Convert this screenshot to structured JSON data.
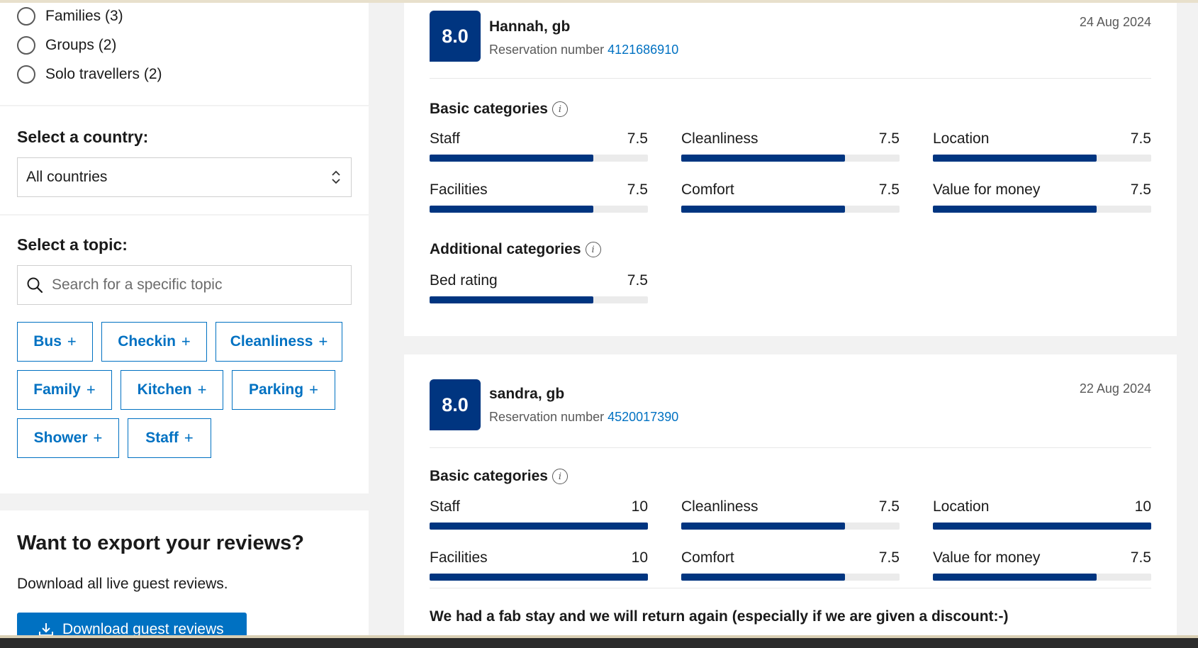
{
  "traveller_filter": {
    "options": [
      {
        "label": "Families (3)"
      },
      {
        "label": "Groups (2)"
      },
      {
        "label": "Solo travellers (2)"
      }
    ]
  },
  "country": {
    "title": "Select a country:",
    "selected": "All countries"
  },
  "topic": {
    "title": "Select a topic:",
    "search_placeholder": "Search for a specific topic",
    "chips": [
      "Bus",
      "Checkin",
      "Cleanliness",
      "Family",
      "Kitchen",
      "Parking",
      "Shower",
      "Staff"
    ],
    "plus": "+"
  },
  "export": {
    "title": "Want to export your reviews?",
    "description": "Download all live guest reviews.",
    "button_label": "Download guest reviews"
  },
  "reviews": [
    {
      "score": "8.0",
      "reviewer": "Hannah, gb",
      "reservation_label": "Reservation number",
      "reservation_number": "4121686910",
      "date": "24 Aug 2024",
      "basic_title": "Basic categories",
      "basic": [
        {
          "label": "Staff",
          "value": "7.5",
          "fraction": 0.75
        },
        {
          "label": "Cleanliness",
          "value": "7.5",
          "fraction": 0.75
        },
        {
          "label": "Location",
          "value": "7.5",
          "fraction": 0.75
        },
        {
          "label": "Facilities",
          "value": "7.5",
          "fraction": 0.75
        },
        {
          "label": "Comfort",
          "value": "7.5",
          "fraction": 0.75
        },
        {
          "label": "Value for money",
          "value": "7.5",
          "fraction": 0.75
        }
      ],
      "additional_title": "Additional categories",
      "additional": [
        {
          "label": "Bed rating",
          "value": "7.5",
          "fraction": 0.75
        }
      ]
    },
    {
      "score": "8.0",
      "reviewer": "sandra, gb",
      "reservation_label": "Reservation number",
      "reservation_number": "4520017390",
      "date": "22 Aug 2024",
      "basic_title": "Basic categories",
      "basic": [
        {
          "label": "Staff",
          "value": "10",
          "fraction": 1.0
        },
        {
          "label": "Cleanliness",
          "value": "7.5",
          "fraction": 0.75
        },
        {
          "label": "Location",
          "value": "10",
          "fraction": 1.0
        },
        {
          "label": "Facilities",
          "value": "10",
          "fraction": 1.0
        },
        {
          "label": "Comfort",
          "value": "7.5",
          "fraction": 0.75
        },
        {
          "label": "Value for money",
          "value": "7.5",
          "fraction": 0.75
        }
      ],
      "text": "We had a fab stay and we will return again (especially if we are given a discount:-)"
    }
  ],
  "colors": {
    "accent": "#0071c2",
    "score_badge": "#003580",
    "bar_fill": "#003580",
    "bar_track": "#ebebeb"
  }
}
